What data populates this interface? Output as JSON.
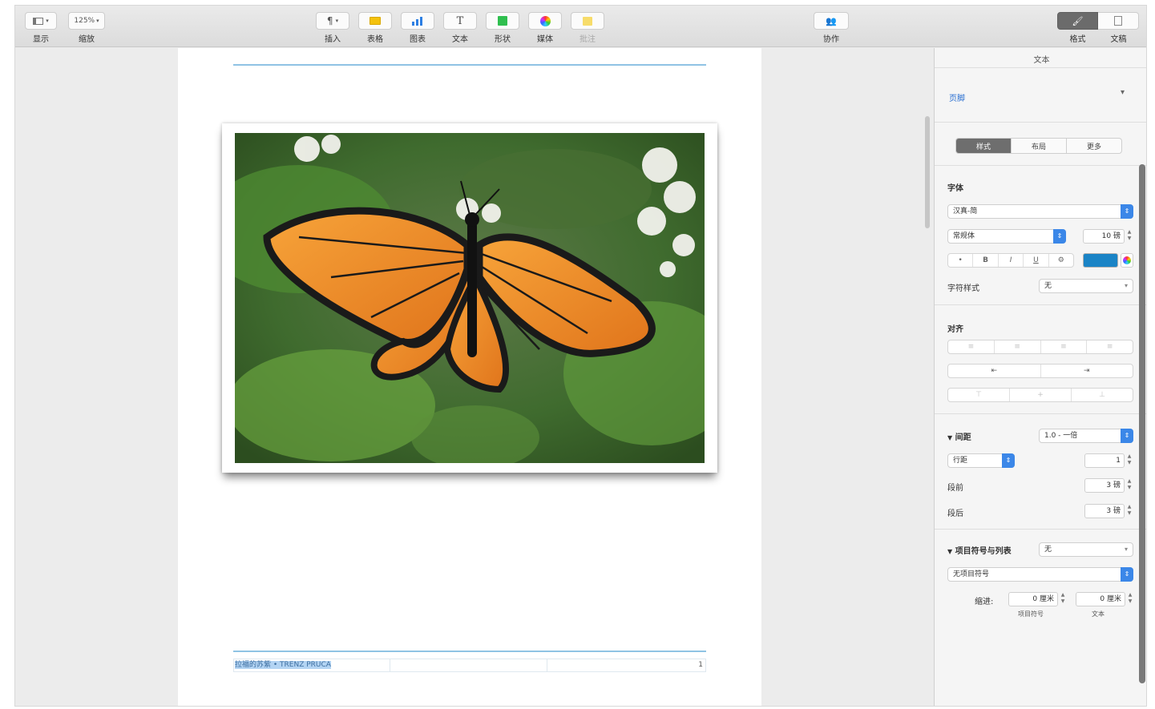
{
  "toolbar": {
    "view_label": "显示",
    "zoom_value": "125%",
    "zoom_label": "缩放",
    "insert_label": "插入",
    "table_label": "表格",
    "chart_label": "图表",
    "text_label": "文本",
    "shape_label": "形状",
    "media_label": "媒体",
    "comment_label": "批注",
    "collaborate_label": "协作",
    "format_label": "格式",
    "document_label": "文稿",
    "colors": {
      "table": "#f4c20d",
      "chart": "#2d7fe3",
      "shape": "#2fbf4f",
      "comment": "#f6d23a"
    }
  },
  "document": {
    "footer_selected_text": "拉福的苏紫 • TRENZ PRUCA",
    "footer_page_number": "1"
  },
  "inspector": {
    "title": "文本",
    "paragraph_style": "页脚",
    "tabs": [
      "样式",
      "布局",
      "更多"
    ],
    "active_tab": "样式",
    "font": {
      "section_label": "字体",
      "family": "汉真-简",
      "typeface": "常规体",
      "size": "10 磅",
      "style_buttons": [
        "•",
        "B",
        "I",
        "U",
        "⚙"
      ],
      "text_color": "#1a84c6",
      "char_style_label": "字符样式",
      "char_style_value": "无"
    },
    "alignment": {
      "section_label": "对齐",
      "indent_decrease": "⇤",
      "indent_increase": "⇥",
      "horizontal": [
        "≡",
        "≡",
        "≡",
        "≡"
      ],
      "vertical": [
        "⊤",
        "+",
        "⊥"
      ]
    },
    "spacing": {
      "section_label": "间距",
      "line_spacing_value": "1.0 - 一倍",
      "mode_value": "行距",
      "mode_amount": "1",
      "before_label": "段前",
      "before_value": "3 磅",
      "after_label": "段后",
      "after_value": "3 磅"
    },
    "bullets": {
      "section_label": "项目符号与列表",
      "list_value": "无",
      "bullet_style": "无项目符号",
      "indent_label": "缩进:",
      "bullet_indent_value": "0 厘米",
      "bullet_indent_caption": "项目符号",
      "text_indent_value": "0 厘米",
      "text_indent_caption": "文本"
    }
  }
}
